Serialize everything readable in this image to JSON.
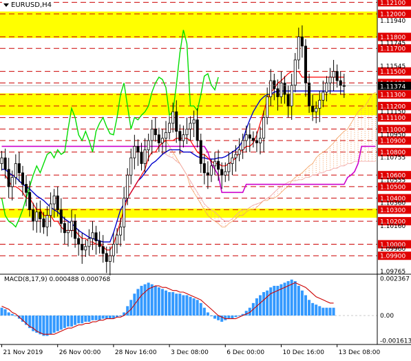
{
  "window": {
    "symbol": "EURUSD,H4"
  },
  "macd_label": {
    "name": "MACD(8,17,9)",
    "values": "0.000488 0.000768"
  },
  "colors": {
    "zone": "#ffff00",
    "level_line": "#cc0000",
    "up_candle": "#000000",
    "kijun": "#0000cc",
    "tenkan": "#ff0000",
    "chikou": "#00dd00",
    "envelope": "#00cc66",
    "purple": "#cc00cc",
    "cloud_a": "#f4a060",
    "cloud_b": "#f0a0a0",
    "macd_hist": "#3399ff",
    "macd_signal": "#cc0000",
    "price_tag_red": "#e00000",
    "current_tag": "#000000"
  },
  "chart_data": [
    {
      "type": "candlestick",
      "title": "EURUSD,H4",
      "ylim": [
        1.0974,
        1.1212
      ],
      "x_ticks": [
        "21 Nov 2019",
        "26 Nov 00:00",
        "28 Nov 16:00",
        "3 Dec 08:00",
        "6 Dec 00:00",
        "10 Dec 16:00",
        "13 Dec 08:00"
      ],
      "x_tick_bars": [
        0,
        16,
        32,
        48,
        64,
        80,
        96
      ],
      "n_bars": 108,
      "current_price": "1.11374",
      "level_labels": [
        "1.12100",
        "1.12000",
        "1.11800",
        "1.11700",
        "1.11500",
        "1.11400",
        "1.11300",
        "1.11200",
        "1.11100",
        "1.11000",
        "1.10900",
        "1.10800",
        "1.10600",
        "1.10500",
        "1.10400",
        "1.10300",
        "1.10200",
        "1.10000",
        "1.09900"
      ],
      "levels": [
        1.121,
        1.12,
        1.118,
        1.117,
        1.115,
        1.114,
        1.113,
        1.112,
        1.111,
        1.11,
        1.109,
        1.108,
        1.106,
        1.105,
        1.104,
        1.103,
        1.102,
        1.1,
        1.099
      ],
      "scale_labels": [
        "1.11940",
        "1.11745",
        "1.11545",
        "1.11374",
        "1.11150",
        "1.10950",
        "1.10755",
        "1.10555",
        "1.10360",
        "1.10160",
        "1.09960",
        "1.09765"
      ],
      "scale_values": [
        1.1194,
        1.11745,
        1.11545,
        1.11374,
        1.1115,
        1.1095,
        1.10755,
        1.10555,
        1.1036,
        1.1016,
        1.0996,
        1.09765
      ],
      "zones": [
        [
          1.1179,
          1.1202
        ],
        [
          1.1112,
          1.1131
        ],
        [
          1.1023,
          1.1031
        ]
      ],
      "close": [
        1.1075,
        1.1065,
        1.105,
        1.1058,
        1.107,
        1.1062,
        1.1052,
        1.1045,
        1.103,
        1.102,
        1.1028,
        1.1022,
        1.1015,
        1.1025,
        1.1035,
        1.1042,
        1.103,
        1.1018,
        1.101,
        1.1012,
        1.102,
        1.1005,
        1.1,
        1.0995,
        1.0998,
        1.1005,
        1.101,
        1.1003,
        1.0998,
        1.0992,
        1.0985,
        1.099,
        1.1,
        1.1008,
        1.1015,
        1.104,
        1.106,
        1.1075,
        1.1085,
        1.108,
        1.107,
        1.1082,
        1.109,
        1.11,
        1.1095,
        1.1088,
        1.1092,
        1.1097,
        1.1105,
        1.1115,
        1.1098,
        1.109,
        1.1095,
        1.11,
        1.1105,
        1.1108,
        1.109,
        1.107,
        1.1062,
        1.106,
        1.1068,
        1.1072,
        1.1065,
        1.106,
        1.1063,
        1.107,
        1.1075,
        1.1078,
        1.1082,
        1.109,
        1.1095,
        1.1092,
        1.109,
        1.1088,
        1.1092,
        1.111,
        1.1128,
        1.1142,
        1.1135,
        1.1128,
        1.114,
        1.113,
        1.112,
        1.1138,
        1.116,
        1.118,
        1.1172,
        1.114,
        1.112,
        1.1115,
        1.1118,
        1.1125,
        1.1132,
        1.114,
        1.1145,
        1.115,
        1.1142,
        1.1138,
        1.1137
      ],
      "tenkan": [
        1.106,
        1.106,
        1.1055,
        1.105,
        1.105,
        1.1048,
        1.1045,
        1.104,
        1.104,
        1.1035,
        1.103,
        1.103,
        1.1025,
        1.1025,
        1.1025,
        1.102,
        1.102,
        1.1015,
        1.1012,
        1.1012,
        1.1012,
        1.1012,
        1.1008,
        1.1005,
        1.1005,
        1.1002,
        1.1002,
        1.1,
        1.1,
        1.0998,
        1.0995,
        1.0995,
        1.1,
        1.101,
        1.102,
        1.103,
        1.104,
        1.1045,
        1.105,
        1.1055,
        1.106,
        1.1065,
        1.1075,
        1.108,
        1.108,
        1.1085,
        1.1088,
        1.109,
        1.109,
        1.109,
        1.1092,
        1.1092,
        1.1092,
        1.1092,
        1.109,
        1.1085,
        1.108,
        1.1078,
        1.1078,
        1.1075,
        1.1072,
        1.107,
        1.107,
        1.1068,
        1.1068,
        1.107,
        1.1072,
        1.1075,
        1.108,
        1.1082,
        1.1085,
        1.1085,
        1.1088,
        1.1095,
        1.1105,
        1.1115,
        1.1125,
        1.1132,
        1.1135,
        1.114,
        1.1142,
        1.1145,
        1.1148,
        1.115,
        1.115,
        1.115,
        1.1145,
        1.1145,
        1.1145,
        1.1145,
        1.1145,
        1.1145,
        1.1145,
        1.1145,
        1.1145,
        1.1145,
        1.1145,
        1.1145,
        1.1145
      ],
      "kijun": [
        1.1065,
        1.1065,
        1.1062,
        1.106,
        1.1058,
        1.1055,
        1.1052,
        1.105,
        1.1048,
        1.1045,
        1.1042,
        1.104,
        1.1038,
        1.1035,
        1.1032,
        1.103,
        1.1028,
        1.1025,
        1.1022,
        1.102,
        1.1018,
        1.1015,
        1.1012,
        1.101,
        1.1008,
        1.1006,
        1.1005,
        1.1004,
        1.1003,
        1.1002,
        1.1002,
        1.1002,
        1.101,
        1.102,
        1.103,
        1.1035,
        1.104,
        1.1045,
        1.105,
        1.1055,
        1.1058,
        1.1062,
        1.1066,
        1.107,
        1.1072,
        1.1075,
        1.1078,
        1.108,
        1.1082,
        1.1082,
        1.1082,
        1.1082,
        1.108,
        1.108,
        1.108,
        1.1078,
        1.1076,
        1.1075,
        1.1075,
        1.1074,
        1.1074,
        1.1074,
        1.1075,
        1.1075,
        1.1076,
        1.1078,
        1.108,
        1.1082,
        1.1085,
        1.109,
        1.11,
        1.1108,
        1.1115,
        1.112,
        1.1125,
        1.1128,
        1.113,
        1.113,
        1.1132,
        1.1133,
        1.1133,
        1.1133,
        1.1133,
        1.1133,
        1.1133,
        1.1133,
        1.1133,
        1.1133,
        1.1133,
        1.1133,
        1.1133,
        1.1133,
        1.1133,
        1.1133,
        1.1133,
        1.1133,
        1.1133,
        1.1133,
        1.1133
      ],
      "purple_line": [
        1.1085,
        1.1085,
        1.1085,
        1.1085,
        1.1085,
        1.1085,
        1.1085,
        1.1085,
        1.1085,
        1.1085,
        1.1085,
        1.1085,
        1.1085,
        1.1085,
        1.1085,
        1.1085,
        1.1085,
        1.1085,
        1.1085,
        1.1085,
        1.1085,
        1.1085,
        1.1085,
        1.1085,
        1.1085,
        1.1085,
        1.1085,
        1.1085,
        1.1085,
        1.1085,
        1.1085,
        1.1085,
        1.1085,
        1.1085,
        1.1085,
        1.1085,
        1.1085,
        1.1085,
        1.1085,
        1.1085,
        1.1085,
        1.1085,
        1.1085,
        1.1085,
        1.1085,
        1.1085,
        1.1085,
        1.1085,
        1.1085,
        1.1085,
        1.1085,
        1.1085,
        1.1085,
        1.1085,
        1.1085,
        1.1085,
        1.1085,
        1.1085,
        1.1085,
        1.108,
        1.107,
        1.1065,
        1.106,
        1.1045,
        1.1045,
        1.1045,
        1.1045,
        1.1045,
        1.1045,
        1.1045,
        1.1052,
        1.1052,
        1.1052,
        1.1052,
        1.1052,
        1.1052,
        1.1052,
        1.1052,
        1.1052,
        1.1052,
        1.1052,
        1.1052,
        1.1052,
        1.1052,
        1.1052,
        1.1052,
        1.1052,
        1.1052,
        1.1052,
        1.1052,
        1.1052,
        1.1052,
        1.1052,
        1.1052,
        1.1052,
        1.1052,
        1.1052,
        1.1052,
        1.1052,
        1.1058,
        1.106,
        1.1063,
        1.107,
        1.1085,
        1.1085,
        1.1085,
        1.1085,
        1.1085
      ],
      "chikou": [
        1.104,
        1.1025,
        1.102,
        1.1018,
        1.1015,
        1.1022,
        1.103,
        1.104,
        1.105,
        1.106,
        1.1068,
        1.1062,
        1.107,
        1.1078,
        1.108,
        1.1075,
        1.1082,
        1.1078,
        1.108,
        1.11,
        1.1118,
        1.111,
        1.1095,
        1.109,
        1.1098,
        1.109,
        1.108,
        1.1098,
        1.1105,
        1.111,
        1.1102,
        1.1096,
        1.1095,
        1.111,
        1.113,
        1.114,
        1.112,
        1.11,
        1.111,
        1.1108,
        1.1112,
        1.1115,
        1.112,
        1.1132,
        1.114,
        1.1145,
        1.1143,
        1.1136,
        1.1112,
        1.1115,
        1.1138,
        1.1166,
        1.1186,
        1.1174,
        1.112,
        1.112,
        1.1116,
        1.113,
        1.1146,
        1.1148,
        1.1138,
        1.1134,
        1.1145
      ],
      "cloud_a": [
        1.1092,
        1.109,
        1.1085,
        1.108,
        1.1075,
        1.107,
        1.1065,
        1.106,
        1.105,
        1.1045,
        1.104,
        1.1035,
        1.103,
        1.1025,
        1.1022,
        1.102,
        1.1018,
        1.1015,
        1.1015,
        1.1018,
        1.102,
        1.1022,
        1.1025,
        1.1025,
        1.1028,
        1.103,
        1.103,
        1.1032,
        1.1035,
        1.1038,
        1.1038,
        1.104,
        1.104,
        1.1042,
        1.1045,
        1.1048,
        1.105,
        1.1055,
        1.1058,
        1.106,
        1.1062,
        1.1065,
        1.1068,
        1.107,
        1.1075,
        1.1078,
        1.108,
        1.1082,
        1.1085,
        1.1088,
        1.1092,
        1.1095,
        1.1098,
        1.11,
        1.1105,
        1.111,
        1.1115,
        1.1118,
        1.112,
        1.1125,
        1.113,
        1.1132,
        1.1135,
        1.1136,
        1.1138,
        1.1138,
        1.1138,
        1.1138,
        1.1138,
        1.1138,
        1.1138,
        1.1138
      ],
      "cloud_b": [
        1.108,
        1.1078,
        1.1076,
        1.1075,
        1.1072,
        1.107,
        1.1065,
        1.106,
        1.1055,
        1.105,
        1.1045,
        1.104,
        1.1035,
        1.1032,
        1.103,
        1.1028,
        1.1025,
        1.1022,
        1.102,
        1.102,
        1.1022,
        1.1025,
        1.1028,
        1.103,
        1.103,
        1.1032,
        1.1034,
        1.1035,
        1.1036,
        1.1038,
        1.104,
        1.1042,
        1.1045,
        1.1048,
        1.105,
        1.1052,
        1.1054,
        1.1055,
        1.1055,
        1.1056,
        1.1056,
        1.1058,
        1.1058,
        1.106,
        1.106,
        1.1062,
        1.1062,
        1.1064,
        1.1064,
        1.1066,
        1.1066,
        1.1068,
        1.1068,
        1.107,
        1.107,
        1.1072,
        1.1072,
        1.1072,
        1.1072,
        1.1072,
        1.1072,
        1.1072,
        1.1072,
        1.1072,
        1.1072,
        1.1072,
        1.1072,
        1.1072,
        1.1072,
        1.1072,
        1.1072,
        1.1072
      ]
    },
    {
      "type": "bar",
      "title": "MACD(8,17,9) 0.000488 0.000768",
      "ylim": [
        -0.00185,
        0.0026
      ],
      "scale_labels": [
        "0.002367",
        "0.00",
        "-0.001613"
      ],
      "scale_values": [
        0.002367,
        0.0,
        -0.001613
      ],
      "histogram": [
        0.0005,
        0.0004,
        0.0002,
        0.0001,
        0.0,
        -0.0002,
        -0.0004,
        -0.0006,
        -0.0008,
        -0.001,
        -0.0011,
        -0.0012,
        -0.0013,
        -0.0013,
        -0.0012,
        -0.0011,
        -0.001,
        -0.0009,
        -0.0008,
        -0.0007,
        -0.0007,
        -0.0006,
        -0.0005,
        -0.0005,
        -0.0004,
        -0.0004,
        -0.0003,
        -0.0003,
        -0.0003,
        -0.0002,
        -0.0002,
        -0.0002,
        -0.0002,
        -0.0001,
        0.0,
        0.0002,
        0.0006,
        0.001,
        0.0014,
        0.0017,
        0.0019,
        0.002,
        0.0021,
        0.002,
        0.0019,
        0.0018,
        0.0017,
        0.0016,
        0.0015,
        0.0015,
        0.0014,
        0.0014,
        0.0013,
        0.0013,
        0.0012,
        0.0011,
        0.001,
        0.0008,
        0.0005,
        0.0002,
        0.0,
        -0.0002,
        -0.0003,
        -0.0004,
        -0.0003,
        -0.0002,
        -0.0002,
        -0.0001,
        0.0,
        0.0001,
        0.0003,
        0.0005,
        0.0008,
        0.0011,
        0.0013,
        0.0015,
        0.0016,
        0.0018,
        0.0019,
        0.0019,
        0.002,
        0.0021,
        0.0022,
        0.0023,
        0.0022,
        0.0019,
        0.0016,
        0.0013,
        0.001,
        0.0008,
        0.0007,
        0.0006,
        0.0005,
        0.0005,
        0.0005,
        0.0005
      ],
      "signal": [
        0.0006,
        0.0005,
        0.0004,
        0.0002,
        0.0001,
        -0.0001,
        -0.0003,
        -0.0005,
        -0.0007,
        -0.0008,
        -0.001,
        -0.0011,
        -0.0012,
        -0.0012,
        -0.0012,
        -0.0012,
        -0.0011,
        -0.001,
        -0.0009,
        -0.0008,
        -0.0008,
        -0.0007,
        -0.0006,
        -0.0006,
        -0.0005,
        -0.0005,
        -0.0004,
        -0.0004,
        -0.0003,
        -0.0003,
        -0.0002,
        -0.0002,
        -0.0002,
        -0.0001,
        -0.0001,
        0.0,
        0.0002,
        0.0004,
        0.0007,
        0.001,
        0.0013,
        0.0015,
        0.0017,
        0.0018,
        0.0019,
        0.0019,
        0.0018,
        0.0018,
        0.0017,
        0.0016,
        0.0016,
        0.0015,
        0.0015,
        0.0014,
        0.0013,
        0.0012,
        0.0011,
        0.001,
        0.0008,
        0.0006,
        0.0004,
        0.0002,
        0.0,
        -0.0001,
        -0.0002,
        -0.0002,
        -0.0002,
        -0.0002,
        -0.0001,
        0.0,
        0.0001,
        0.0002,
        0.0004,
        0.0006,
        0.0008,
        0.001,
        0.0012,
        0.0014,
        0.0015,
        0.0016,
        0.0017,
        0.0018,
        0.0019,
        0.002,
        0.0021,
        0.002,
        0.0019,
        0.0018,
        0.0016,
        0.0014,
        0.0012,
        0.0011,
        0.001,
        0.0009,
        0.0008,
        0.0008
      ]
    }
  ]
}
